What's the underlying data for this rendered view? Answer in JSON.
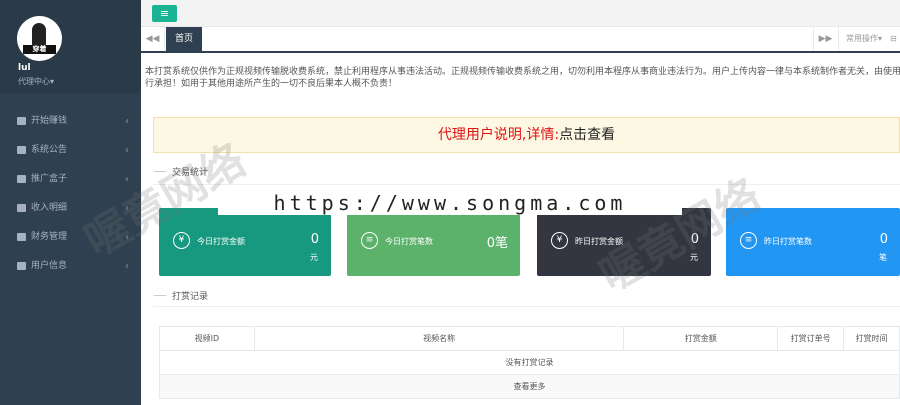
{
  "sidebar": {
    "username": "lul",
    "role": "代理中心▾",
    "avatar_caption": "穿着",
    "items": [
      {
        "label": "开始赚钱",
        "icon": "database-icon"
      },
      {
        "label": "系统公告",
        "icon": "gear-icon"
      },
      {
        "label": "推广盒子",
        "icon": "car-icon"
      },
      {
        "label": "收入明细",
        "icon": "card-icon"
      },
      {
        "label": "财务管理",
        "icon": "building-icon"
      },
      {
        "label": "用户信息",
        "icon": "users-icon"
      }
    ],
    "chevron": "‹"
  },
  "topbar": {
    "menu_icon": "≡"
  },
  "tabs": {
    "prev": "◀◀",
    "home": "首页",
    "next": "▶▶",
    "ops": "常用操作▾",
    "close": "⊟"
  },
  "notice": {
    "line1": "本打赏系统仅供作为正规视频传输脱收费系统，禁止利用程序从事违法活动。正规视频传输收费系统之用，切勿利用本程序从事商业违法行为。用户上传内容一律与本系统制作者无关，由使用用户",
    "line2": "行承担！如用于其他用途所产生的一切不良后果本人概不负责！"
  },
  "banner": {
    "red_text": "代理用户说明,详情:",
    "dark_text": "点击查看"
  },
  "stats": {
    "title": "交易统计",
    "cards": [
      {
        "label": "今日打赏金额",
        "value": "0",
        "unit": "元",
        "color": "#17997f",
        "icon": "yen-icon"
      },
      {
        "label": "今日打赏笔数",
        "value": "0笔",
        "unit": "",
        "color": "#5cb26b",
        "icon": "list-icon"
      },
      {
        "label": "昨日打赏金额",
        "value": "0",
        "unit": "元",
        "color": "#333640",
        "icon": "yen-icon"
      },
      {
        "label": "昨日打赏笔数",
        "value": "0",
        "unit": "笔",
        "color": "#2196f3",
        "icon": "list-icon"
      }
    ]
  },
  "records": {
    "title": "打赏记录",
    "columns": [
      "视频ID",
      "视频名称",
      "打赏金额",
      "打赏订单号",
      "打赏时间"
    ],
    "empty": "没有打赏记录",
    "more": "查看更多"
  },
  "watermark": {
    "text": "喔竟网络",
    "url": "https://www.songma.com"
  }
}
